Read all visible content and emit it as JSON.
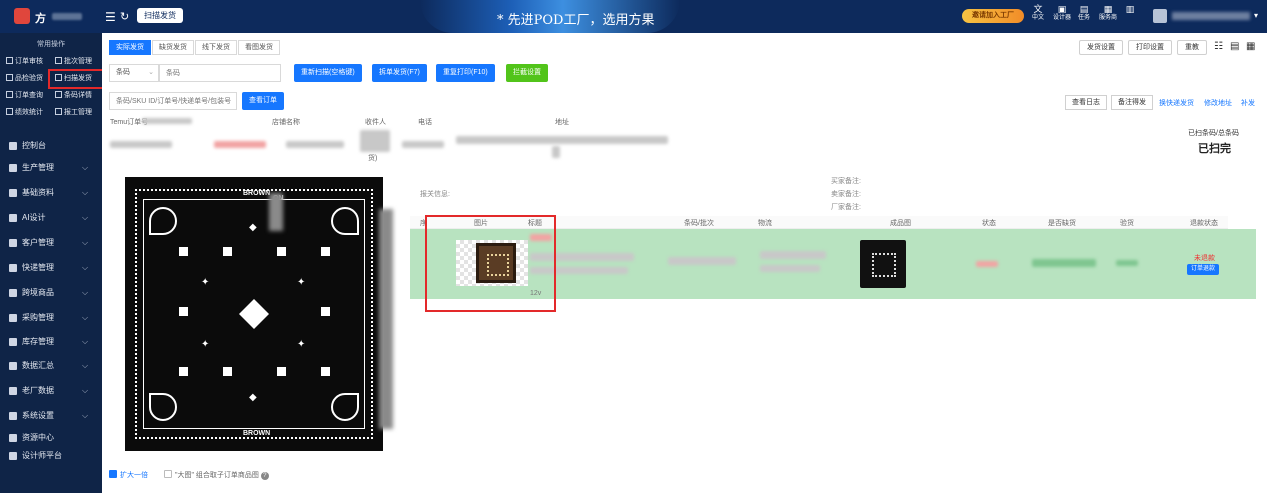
{
  "topbar": {
    "brand": "方",
    "page_tab": "扫描发货",
    "slogan": "* 先进POD工厂，选用方果",
    "promo": "邀请加入工厂",
    "tools": [
      "中文",
      "设计器",
      "任务",
      "服务商",
      "",
      ""
    ]
  },
  "sidebar": {
    "header": "常用操作",
    "quick": [
      "订单审核",
      "批次管理",
      "品检验货",
      "扫描发货",
      "订单查询",
      "条码详情",
      "绩效统计",
      "报工管理"
    ],
    "items": [
      {
        "label": "控制台",
        "caret": false
      },
      {
        "label": "生产管理",
        "caret": true
      },
      {
        "label": "基础资料",
        "caret": true
      },
      {
        "label": "AI设计",
        "caret": true
      },
      {
        "label": "客户管理",
        "caret": true
      },
      {
        "label": "快递管理",
        "caret": true
      },
      {
        "label": "跨境商品",
        "caret": true
      },
      {
        "label": "采购管理",
        "caret": true
      },
      {
        "label": "库存管理",
        "caret": true
      },
      {
        "label": "数据汇总",
        "caret": true
      },
      {
        "label": "老厂数据",
        "caret": true
      },
      {
        "label": "系统设置",
        "caret": true
      },
      {
        "label": "资源中心",
        "caret": false
      },
      {
        "label": "设计师平台",
        "caret": false
      }
    ]
  },
  "tabs": [
    "实际发货",
    "缺货发货",
    "线下发货",
    "看图发货"
  ],
  "top_right": {
    "ship_settings": "发货设置",
    "print_settings": "打印设置",
    "reprint": "重教"
  },
  "scan": {
    "select_value": "条码",
    "input_placeholder": "条码",
    "rescan": "重新扫描(空格键)",
    "split_ship": "拆单发货(F7)",
    "reprint": "重复打印(F10)",
    "intercept": "拦截设置",
    "search_placeholder": "条码/SKU ID/订单号/快递单号/包装号",
    "view_order": "查看订单"
  },
  "actions": {
    "view_log": "查看日志",
    "note_send": "备注得发",
    "change_ship": "换快递发货",
    "edit_address": "修改地址",
    "reissue": "补发"
  },
  "order_headers": [
    "Temu订单号",
    "店铺名称",
    "收件人",
    "电话",
    "地址"
  ],
  "order_fragment": "货)",
  "scan_progress": {
    "label": "已扫条码/总条码",
    "status": "已扫完"
  },
  "notes": {
    "buyer": "买家备注:",
    "seller": "卖家备注:",
    "factory": "厂家备注:",
    "customs": "报关信息:"
  },
  "item_headers": [
    "序",
    "图片",
    "标题",
    "条码/批次",
    "物流",
    "成品图",
    "状态",
    "是否缺货",
    "验货",
    "退款状态"
  ],
  "item_row": {
    "qty": "12v",
    "refund_status": "未退款",
    "refund_btn": "订单退款"
  },
  "preview_opts": {
    "enlarge": "扩大一倍",
    "large_label": "\"大图\" 组合取子订单商品图",
    "help": "?"
  },
  "bandana_text": {
    "top": "BROWN",
    "top_right": "ON",
    "bottom": "BROWN"
  },
  "colors": {
    "topbar": "#0d2a5c",
    "sidebar": "#0f2447",
    "primary": "#1677ff",
    "success": "#52c41a",
    "highlight": "#e3292a",
    "row_bg": "#b8e3c0"
  }
}
